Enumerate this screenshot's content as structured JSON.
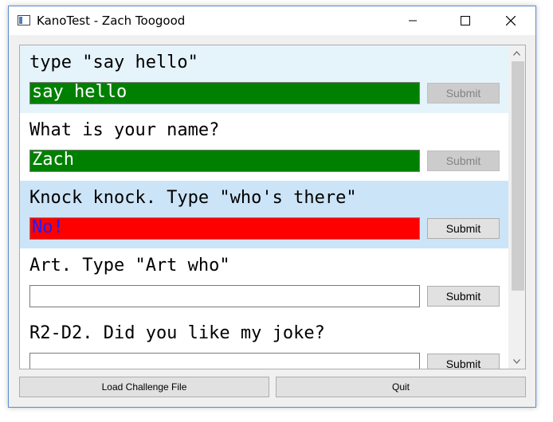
{
  "window": {
    "title": "KanoTest - Zach Toogood"
  },
  "challenges": [
    {
      "prompt": "type \"say hello\"",
      "answer": "say hello",
      "status": "correct",
      "submit_label": "Submit"
    },
    {
      "prompt": "What is your name?",
      "answer": "Zach",
      "status": "correct",
      "submit_label": "Submit"
    },
    {
      "prompt": "Knock knock. Type \"who's there\"",
      "answer": "No!",
      "status": "wrong",
      "submit_label": "Submit"
    },
    {
      "prompt": "Art. Type \"Art who\"",
      "answer": "",
      "status": "empty",
      "submit_label": "Submit"
    },
    {
      "prompt": "R2-D2. Did you like my joke?",
      "answer": "",
      "status": "empty",
      "submit_label": "Submit"
    }
  ],
  "footer": {
    "load_label": "Load Challenge File",
    "quit_label": "Quit"
  },
  "colors": {
    "correct": "#008000",
    "wrong": "#ff0000",
    "wrong_text": "#1d1dff",
    "highlight": "#e5f3fb",
    "focus": "#cce4f7"
  }
}
